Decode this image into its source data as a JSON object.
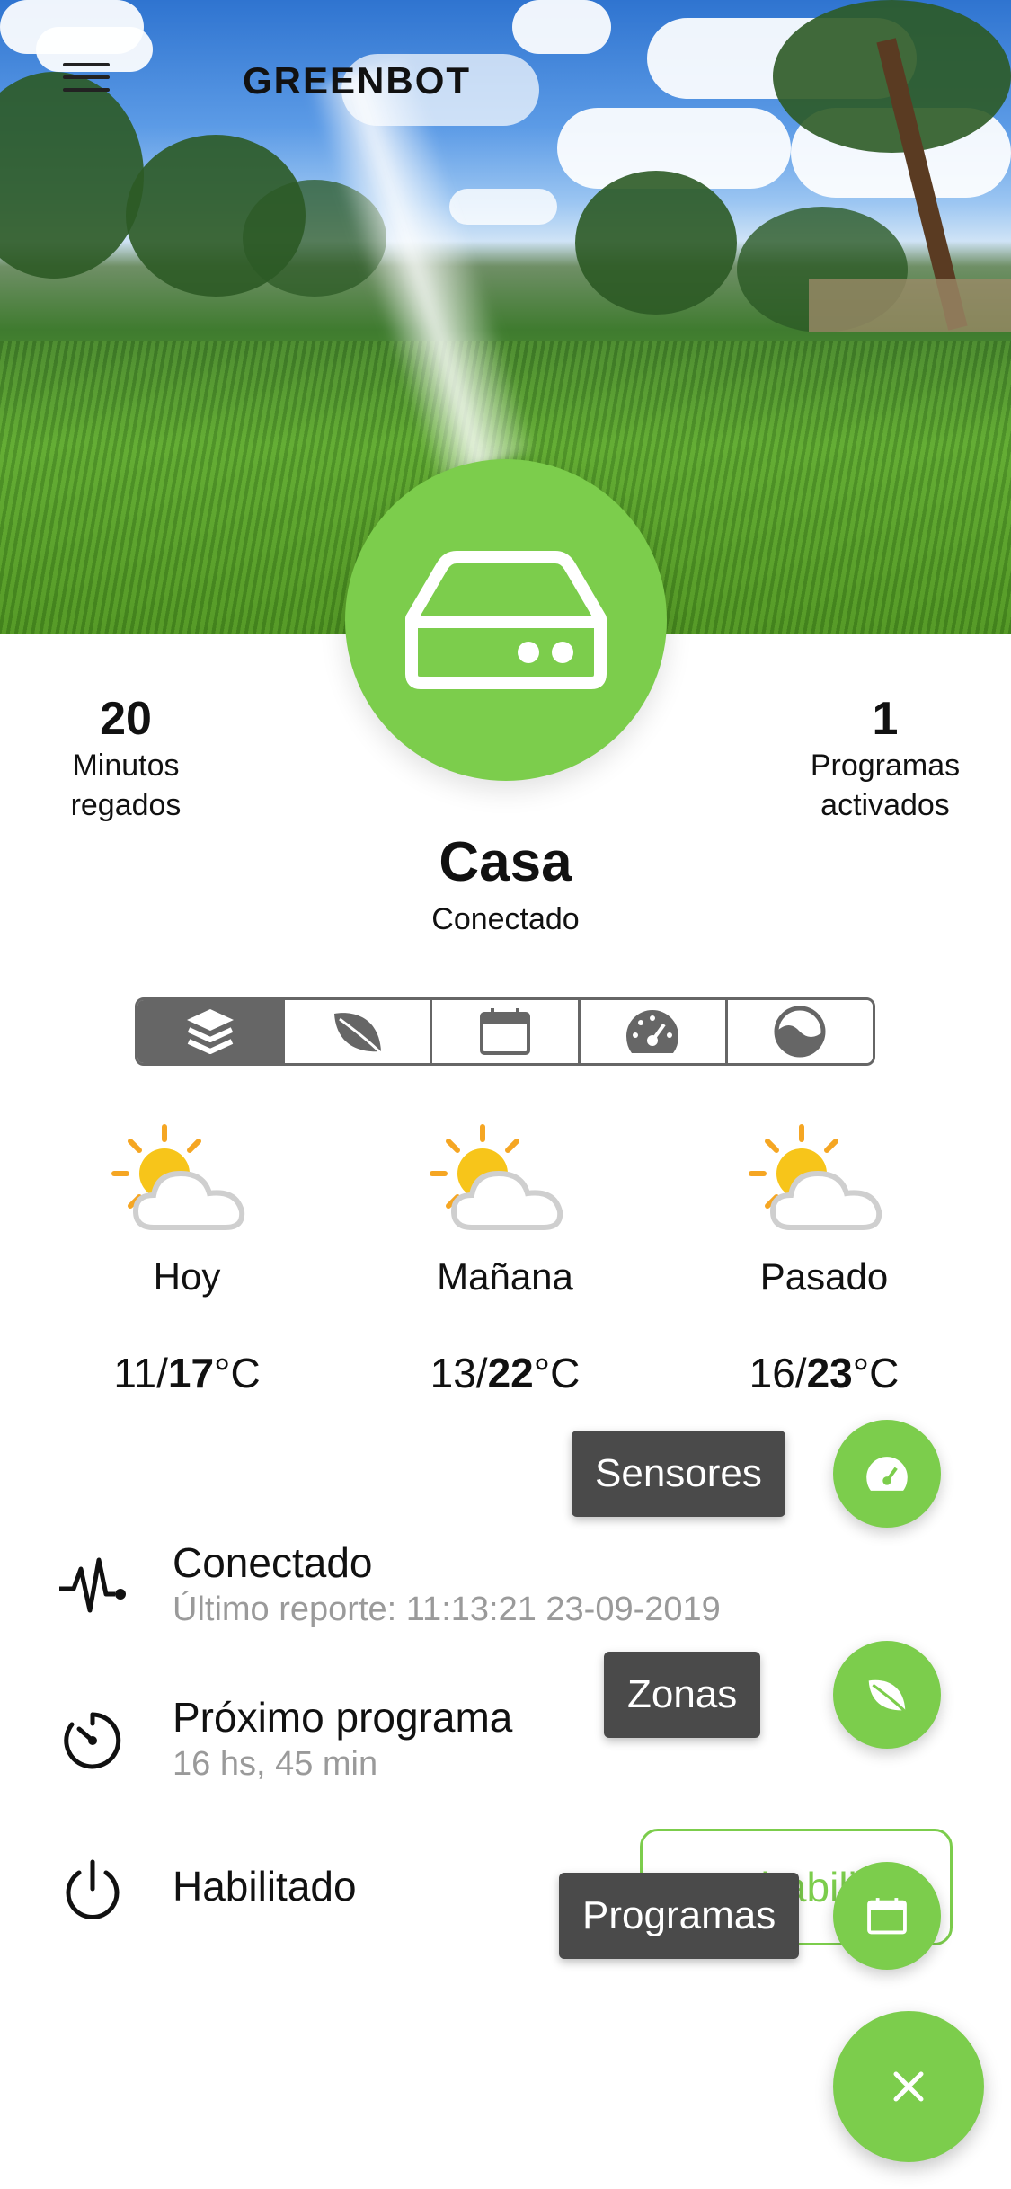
{
  "header": {
    "title": "GREENBOT",
    "menu_icon": "hamburger-menu-icon"
  },
  "stats": {
    "minutes": {
      "value": "20",
      "label_line1": "Minutos",
      "label_line2": "regados"
    },
    "programs": {
      "value": "1",
      "label_line1": "Programas",
      "label_line2": "activados"
    }
  },
  "device": {
    "name": "Casa",
    "status": "Conectado",
    "icon": "controller-box-icon"
  },
  "tabs": [
    {
      "icon": "layers-icon",
      "active": true
    },
    {
      "icon": "leaf-icon",
      "active": false
    },
    {
      "icon": "calendar-icon",
      "active": false
    },
    {
      "icon": "gauge-icon",
      "active": false
    },
    {
      "icon": "landscape-circle-icon",
      "active": false
    }
  ],
  "weather": [
    {
      "day": "Hoy",
      "min": "11",
      "max": "17",
      "unit": "°C",
      "icon": "partly-cloudy-icon"
    },
    {
      "day": "Mañana",
      "min": "13",
      "max": "22",
      "unit": "°C",
      "icon": "partly-cloudy-icon"
    },
    {
      "day": "Pasado",
      "min": "16",
      "max": "23",
      "unit": "°C",
      "icon": "partly-cloudy-icon"
    }
  ],
  "info": {
    "connection": {
      "title": "Conectado",
      "subtitle": "Último reporte: 11:13:21 23-09-2019",
      "icon": "pulse-icon"
    },
    "next_program": {
      "title": "Próximo programa",
      "subtitle": "16 hs, 45 min",
      "icon": "timer-icon"
    },
    "enabled": {
      "title": "Habilitado",
      "icon": "power-icon",
      "button_label": "Deshabilitar"
    }
  },
  "speed_dial": {
    "sensors_label": "Sensores",
    "zones_label": "Zonas",
    "programs_label": "Programas",
    "close_icon": "close-icon"
  },
  "colors": {
    "accent": "#7ccd4c",
    "tooltip_bg": "#4a4a4a",
    "segment_active": "#666666"
  }
}
